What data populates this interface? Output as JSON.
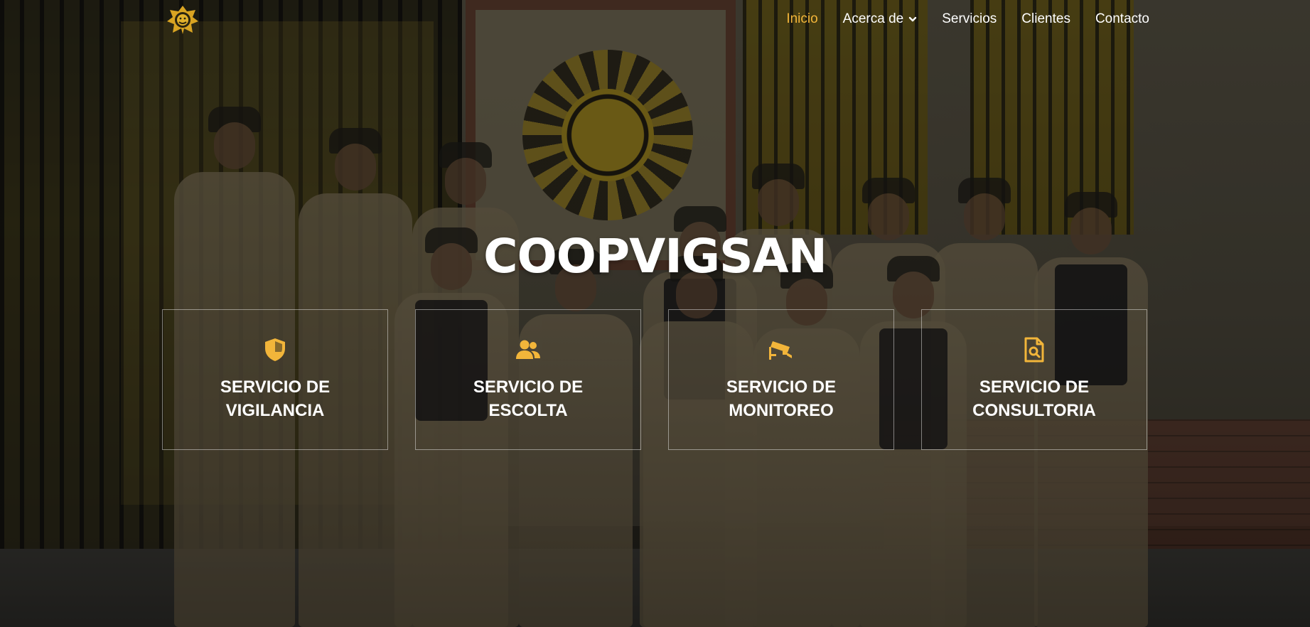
{
  "brand": {
    "logo_icon": "coopvigsan-emblem-logo",
    "accent_color": "#f2b53a"
  },
  "nav": {
    "items": [
      {
        "label": "Inicio",
        "active": true
      },
      {
        "label": "Acerca de",
        "has_dropdown": true,
        "icon": "chevron-down-icon"
      },
      {
        "label": "Servicios"
      },
      {
        "label": "Clientes"
      },
      {
        "label": "Contacto"
      }
    ]
  },
  "hero": {
    "title": "COOPVIGSAN",
    "background": "security-team-group-photo"
  },
  "services": [
    {
      "icon": "shield-icon",
      "label": "SERVICIO DE VIGILANCIA"
    },
    {
      "icon": "users-icon",
      "label": "SERVICIO DE ESCOLTA"
    },
    {
      "icon": "security-camera-icon",
      "label": "SERVICIO DE MONITOREO"
    },
    {
      "icon": "file-search-icon",
      "label": "SERVICIO DE CONSULTORIA"
    }
  ]
}
